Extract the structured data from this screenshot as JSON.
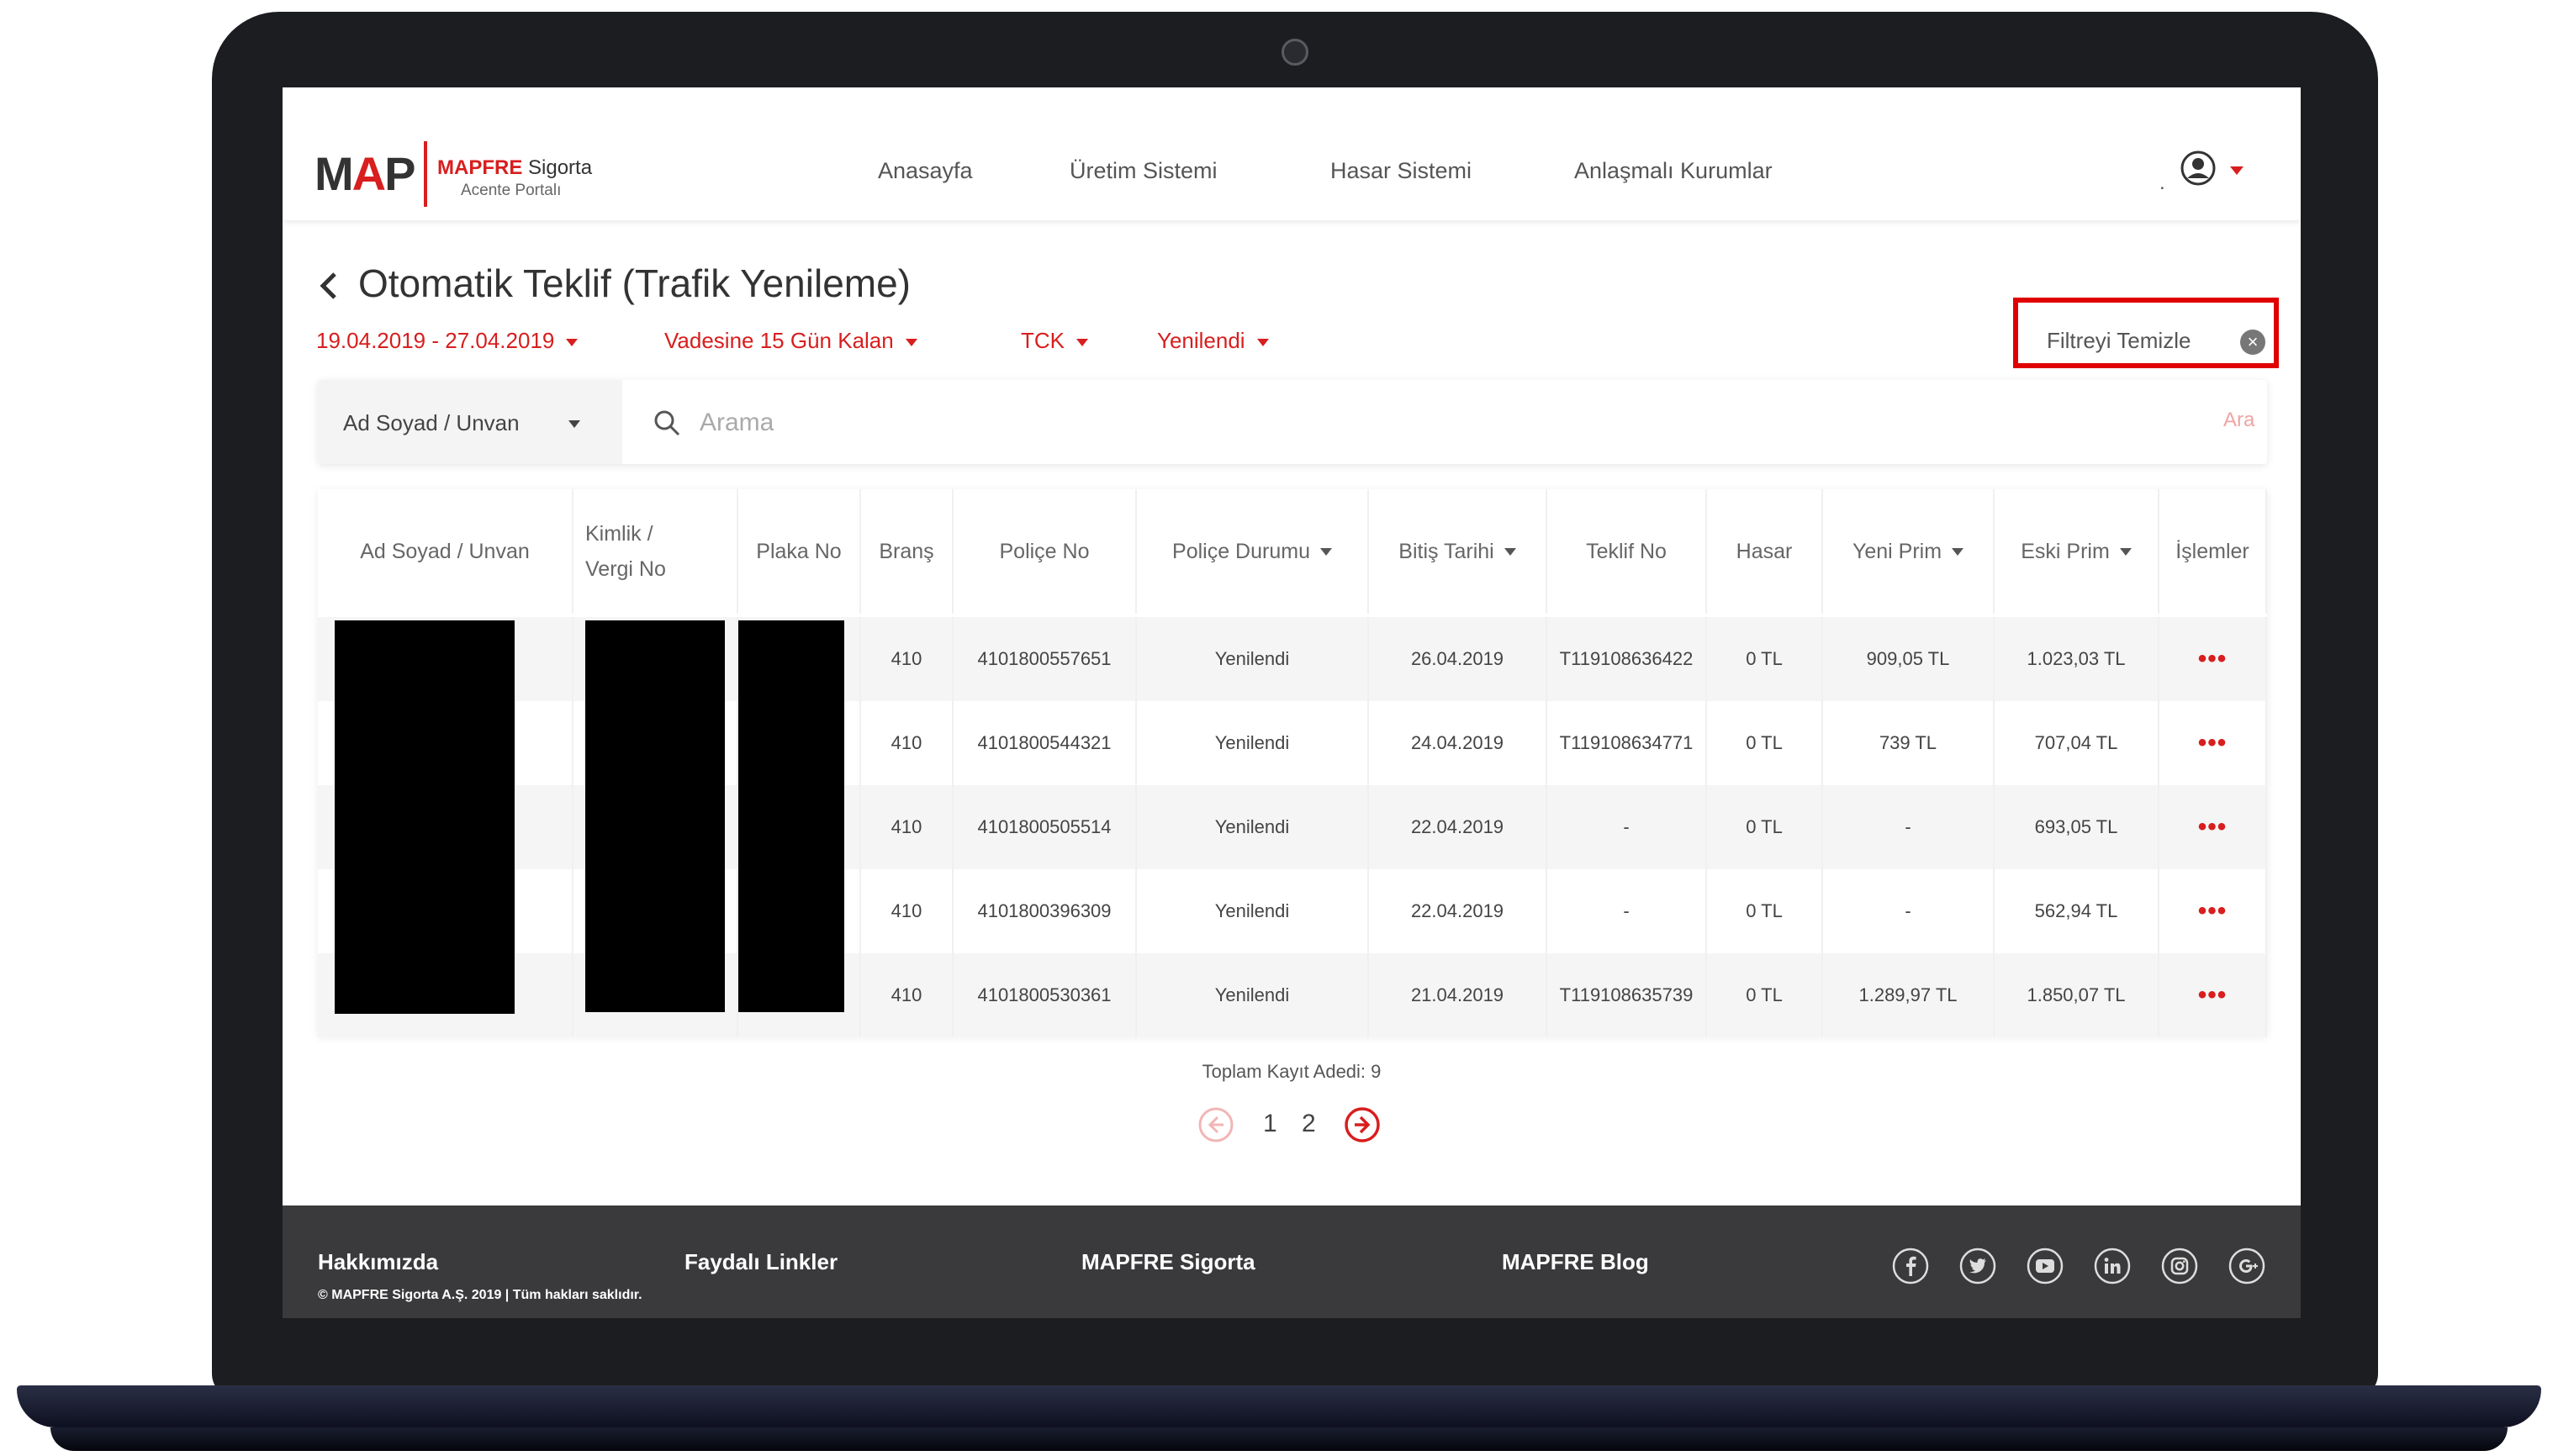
{
  "header": {
    "logo_prefix": "M",
    "logo_accent": "A",
    "logo_suffix": "P",
    "brand_name": "MAPFRE",
    "brand_suffix": "Sigorta",
    "brand_sub": "Acente Portalı",
    "nav": [
      "Anasayfa",
      "Üretim Sistemi",
      "Hasar Sistemi",
      "Anlaşmalı Kurumlar"
    ],
    "user_prefix": "."
  },
  "page": {
    "title": "Otomatik Teklif (Trafik Yenileme)",
    "filters": [
      "19.04.2019 - 27.04.2019",
      "Vadesine 15 Gün Kalan",
      "TCK",
      "Yenilendi"
    ],
    "clear_filter_label": "Filtreyi Temizle"
  },
  "search": {
    "type_label": "Ad Soyad / Unvan",
    "placeholder": "Arama",
    "button_label": "Ara"
  },
  "table": {
    "headers": [
      {
        "label": "Ad Soyad / Unvan",
        "sortable": false
      },
      {
        "label": "Kimlik / Vergi No",
        "sortable": false
      },
      {
        "label": "Plaka No",
        "sortable": false
      },
      {
        "label": "Branş",
        "sortable": false
      },
      {
        "label": "Poliçe No",
        "sortable": false
      },
      {
        "label": "Poliçe Durumu",
        "sortable": true
      },
      {
        "label": "Bitiş Tarihi",
        "sortable": true
      },
      {
        "label": "Teklif No",
        "sortable": false
      },
      {
        "label": "Hasar",
        "sortable": false
      },
      {
        "label": "Yeni Prim",
        "sortable": true
      },
      {
        "label": "Eski Prim",
        "sortable": true
      },
      {
        "label": "İşlemler",
        "sortable": false
      }
    ],
    "rows": [
      {
        "brans": "410",
        "police_no": "4101800557651",
        "durum": "Yenilendi",
        "bitis": "26.04.2019",
        "teklif_no": "T119108636422",
        "hasar": "0 TL",
        "yeni_prim": "909,05 TL",
        "eski_prim": "1.023,03 TL",
        "actions": "•••"
      },
      {
        "brans": "410",
        "police_no": "4101800544321",
        "durum": "Yenilendi",
        "bitis": "24.04.2019",
        "teklif_no": "T119108634771",
        "hasar": "0 TL",
        "yeni_prim": "739 TL",
        "eski_prim": "707,04 TL",
        "actions": "•••"
      },
      {
        "brans": "410",
        "police_no": "4101800505514",
        "durum": "Yenilendi",
        "bitis": "22.04.2019",
        "teklif_no": "-",
        "hasar": "0 TL",
        "yeni_prim": "-",
        "eski_prim": "693,05 TL",
        "actions": "•••"
      },
      {
        "brans": "410",
        "police_no": "4101800396309",
        "durum": "Yenilendi",
        "bitis": "22.04.2019",
        "teklif_no": "-",
        "hasar": "0 TL",
        "yeni_prim": "-",
        "eski_prim": "562,94 TL",
        "actions": "•••"
      },
      {
        "brans": "410",
        "police_no": "4101800530361",
        "durum": "Yenilendi",
        "bitis": "21.04.2019",
        "teklif_no": "T119108635739",
        "hasar": "0 TL",
        "yeni_prim": "1.289,97 TL",
        "eski_prim": "1.850,07 TL",
        "actions": "•••"
      }
    ]
  },
  "pagination": {
    "total_label": "Toplam Kayıt Adedi: 9",
    "pages": [
      "1",
      "2"
    ]
  },
  "footer": {
    "links": [
      "Hakkımızda",
      "Faydalı Linkler",
      "MAPFRE Sigorta",
      "MAPFRE Blog"
    ],
    "copyright": "© MAPFRE Sigorta A.Ş. 2019 | Tüm hakları saklıdır.",
    "social": [
      "facebook-icon",
      "twitter-icon",
      "youtube-icon",
      "linkedin-icon",
      "instagram-icon",
      "google-plus-icon"
    ]
  },
  "colors": {
    "brand_red": "#d81e1e",
    "highlight_red": "#e00000",
    "footer_bg": "#3a3a3c",
    "laptop_frame": "#1c1d20"
  }
}
